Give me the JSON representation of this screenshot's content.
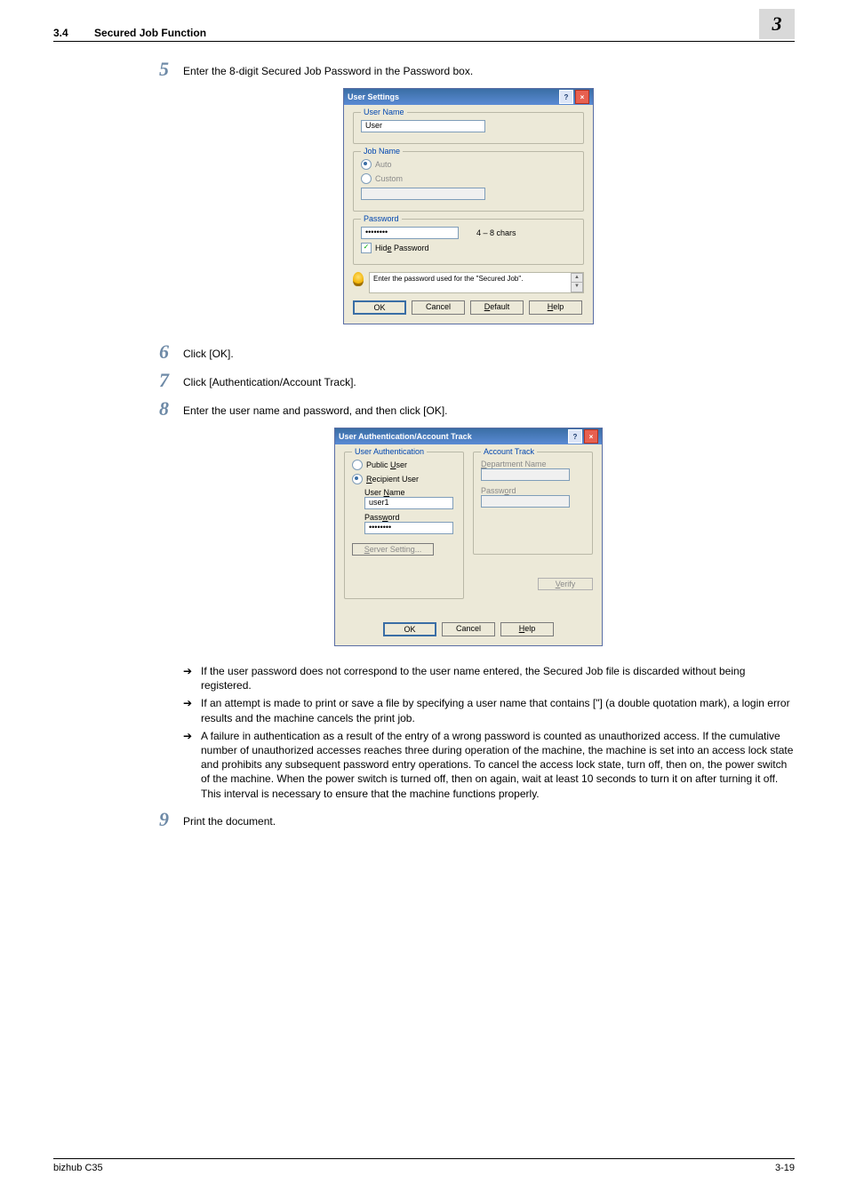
{
  "header": {
    "section_number": "3.4",
    "section_title": "Secured Job Function",
    "chapter_glyph": "3"
  },
  "steps": {
    "s5": {
      "num": "5",
      "text": "Enter the 8-digit Secured Job Password in the Password box."
    },
    "s6": {
      "num": "6",
      "text": "Click [OK]."
    },
    "s7": {
      "num": "7",
      "text": "Click [Authentication/Account Track]."
    },
    "s8": {
      "num": "8",
      "text": "Enter the user name and password, and then click [OK]."
    },
    "s9": {
      "num": "9",
      "text": "Print the document."
    }
  },
  "bullets": {
    "b1": "If the user password does not correspond to the user name entered, the Secured Job file is discarded without being registered.",
    "b2": "If an attempt is made to print or save a file by specifying a user name that contains [\"] (a double quotation mark), a login error results and the machine cancels the print job.",
    "b3": "A failure in authentication as a result of the entry of a wrong password is counted as unauthorized access. If the cumulative number of unauthorized accesses reaches three during operation of the machine, the machine is set into an access lock state and prohibits any subsequent password entry operations. To cancel the access lock state, turn off, then on, the power switch of the machine. When the power switch is turned off, then on again, wait at least 10 seconds to turn it on after turning it off. This interval is necessary to ensure that the machine functions properly."
  },
  "dialog1": {
    "title": "User Settings",
    "groups": {
      "username": {
        "legend": "User Name",
        "value": "User"
      },
      "jobname": {
        "legend": "Job Name",
        "radio_auto": "Auto",
        "radio_custom": "Custom"
      },
      "password": {
        "legend": "Password",
        "value": "••••••••",
        "range": "4 – 8 chars",
        "hide_label": "Hide Password"
      }
    },
    "hint": "Enter the password used for the \"Secured Job\".",
    "buttons": {
      "ok": "OK",
      "cancel": "Cancel",
      "default": "Default",
      "help": "Help"
    }
  },
  "dialog2": {
    "title": "User Authentication/Account Track",
    "left": {
      "legend": "User Authentication",
      "public": "Public User",
      "recipient": "Recipient User",
      "username_label": "User Name",
      "username_value": "user1",
      "password_label": "Password",
      "password_value": "••••••••",
      "server_setting": "Server Setting..."
    },
    "right": {
      "legend": "Account Track",
      "dept_label": "Department Name",
      "pw_label": "Password",
      "verify": "Verify"
    },
    "buttons": {
      "ok": "OK",
      "cancel": "Cancel",
      "help": "Help"
    }
  },
  "footer": {
    "left": "bizhub C35",
    "right": "3-19"
  }
}
